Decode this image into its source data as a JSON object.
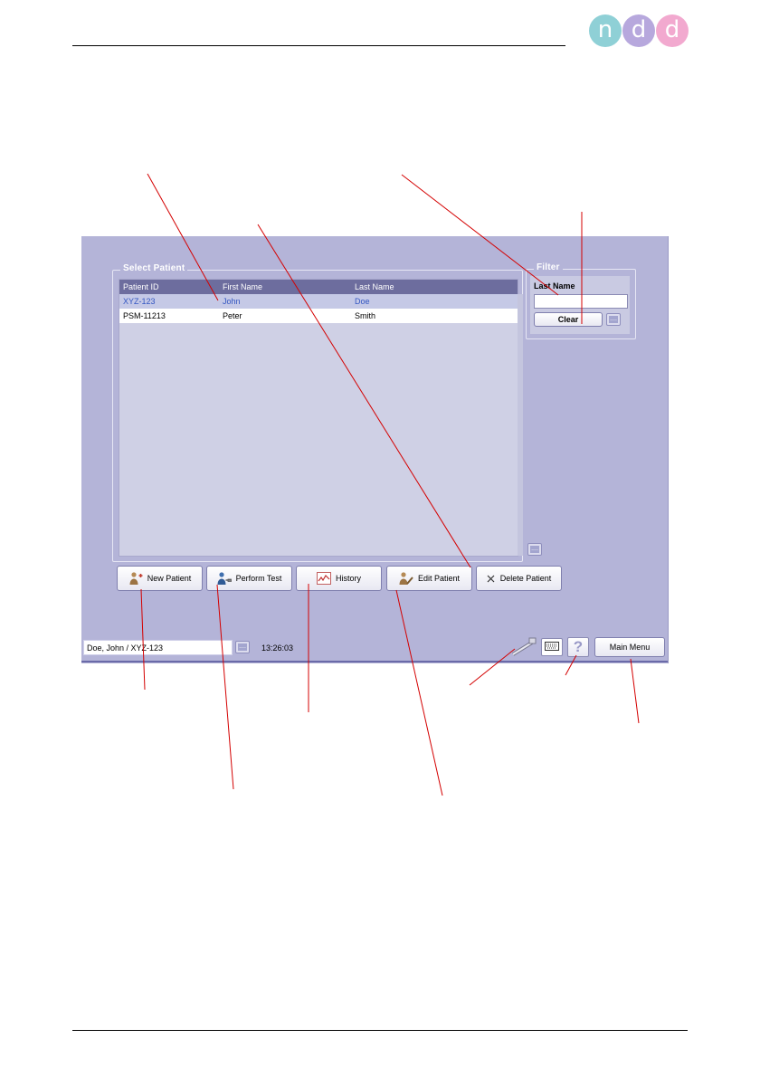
{
  "logo": {
    "letters": [
      "n",
      "d",
      "d"
    ]
  },
  "select_patient": {
    "title": "Select Patient",
    "columns": [
      "Patient ID",
      "First Name",
      "Last Name"
    ],
    "rows": [
      {
        "id": "XYZ-123",
        "first": "John",
        "last": "Doe",
        "selected": true
      },
      {
        "id": "PSM-11213",
        "first": "Peter",
        "last": "Smith",
        "selected": false
      }
    ]
  },
  "filter": {
    "title": "Filter",
    "label": "Last Name",
    "value": "",
    "clear_label": "Clear",
    "more_label": "...."
  },
  "actions": {
    "new_patient": "New Patient",
    "perform_test": "Perform Test",
    "history": "History",
    "edit_patient": "Edit Patient",
    "delete_patient": "Delete Patient",
    "more_label": "...."
  },
  "statusbar": {
    "current_patient": "Doe, John / XYZ-123",
    "more_label": "....",
    "time": "13:26:03",
    "help_label": "?",
    "main_menu": "Main Menu"
  },
  "colors": {
    "screen_bg": "#b4b4d8",
    "header_bg": "#6d6d9e",
    "selected_text": "#3457c2",
    "callout_line": "#d40000"
  },
  "icons": [
    "person-add-icon",
    "person-test-icon",
    "history-chart-icon",
    "person-edit-icon",
    "close-icon",
    "keyboard-icon",
    "spirette-icon",
    "help-icon"
  ]
}
